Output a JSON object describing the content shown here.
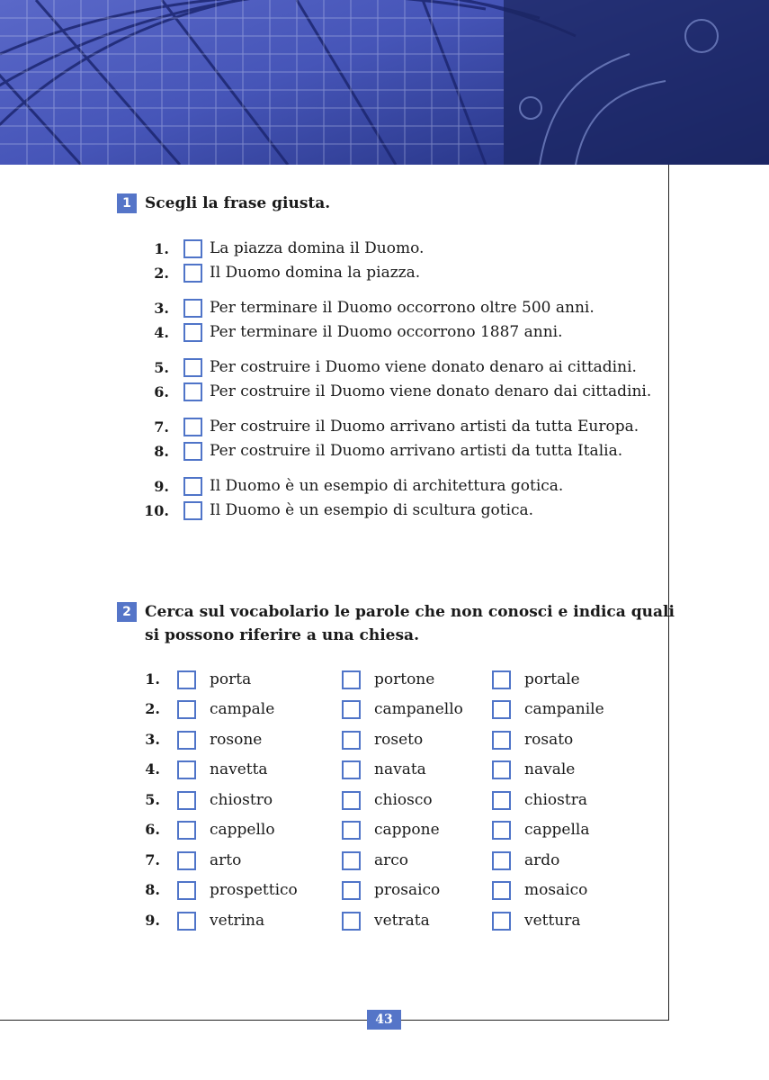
{
  "page_number": "43",
  "exercise1": {
    "number": "1",
    "instruction": "Scegli la frase giusta.",
    "items": [
      {
        "n": "1.",
        "text": "La piazza domina il Duomo."
      },
      {
        "n": "2.",
        "text": "Il Duomo domina la piazza."
      },
      {
        "n": "3.",
        "text": "Per terminare il Duomo occorrono oltre 500 anni."
      },
      {
        "n": "4.",
        "text": "Per terminare il Duomo occorrono 1887 anni."
      },
      {
        "n": "5.",
        "text": "Per costruire i Duomo viene donato denaro ai cittadini."
      },
      {
        "n": "6.",
        "text": "Per costruire il Duomo viene donato denaro dai cittadini."
      },
      {
        "n": "7.",
        "text": "Per costruire il Duomo arrivano artisti da tutta Europa."
      },
      {
        "n": "8.",
        "text": "Per costruire il Duomo arrivano artisti da tutta Italia."
      },
      {
        "n": "9.",
        "text": "Il Duomo è un esempio di architettura gotica."
      },
      {
        "n": "10.",
        "text": "Il Duomo è un esempio di scultura gotica."
      }
    ]
  },
  "exercise2": {
    "number": "2",
    "instruction_line1": "Cerca sul vocabolario le parole che non conosci e indica quali",
    "instruction_line2": "si possono riferire a una chiesa.",
    "rows": [
      {
        "n": "1.",
        "words": [
          "porta",
          "portone",
          "portale"
        ]
      },
      {
        "n": "2.",
        "words": [
          "campale",
          "campanello",
          "campanile"
        ]
      },
      {
        "n": "3.",
        "words": [
          "rosone",
          "roseto",
          "rosato"
        ]
      },
      {
        "n": "4.",
        "words": [
          "navetta",
          "navata",
          "navale"
        ]
      },
      {
        "n": "5.",
        "words": [
          "chiostro",
          "chiosco",
          "chiostra"
        ]
      },
      {
        "n": "6.",
        "words": [
          "cappello",
          "cappone",
          "cappella"
        ]
      },
      {
        "n": "7.",
        "words": [
          "arto",
          "arco",
          "ardo"
        ]
      },
      {
        "n": "8.",
        "words": [
          "prospettico",
          "prosaico",
          "mosaico"
        ]
      },
      {
        "n": "9.",
        "words": [
          "vetrina",
          "vetrata",
          "vettura"
        ]
      }
    ]
  }
}
